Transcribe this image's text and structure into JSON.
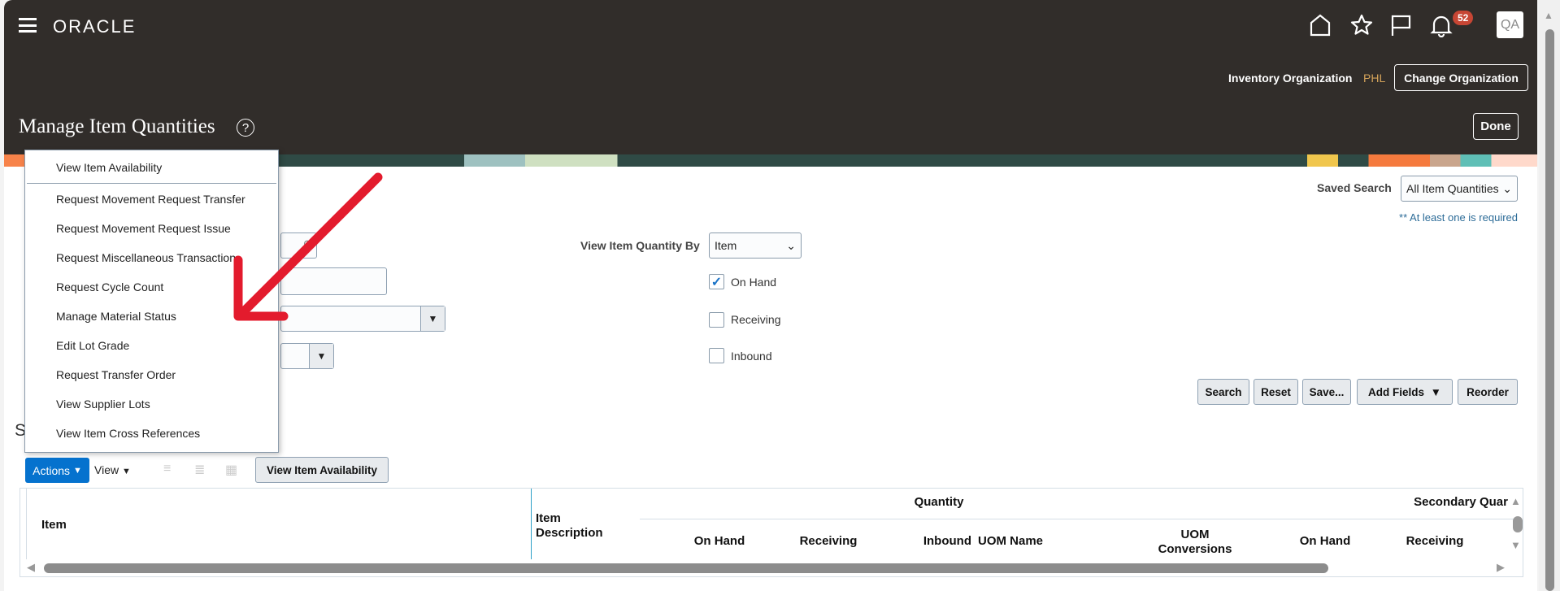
{
  "header": {
    "logo": "ORACLE",
    "notifications_count": "52",
    "avatar": "QA",
    "inventory_org_label": "Inventory Organization",
    "inventory_org_value": "PHL",
    "change_org_button": "Change Organization",
    "page_title": "Manage Item Quantities",
    "help": "?",
    "done_button": "Done"
  },
  "icons": [
    "menu-icon",
    "home-icon",
    "star-icon",
    "flag-icon",
    "bell-icon",
    "help-icon",
    "search-icon"
  ],
  "search": {
    "saved_search_label": "Saved Search",
    "saved_search_value": "All Item Quantities",
    "required_note": "** At least one is required",
    "view_by_label": "View Item Quantity By",
    "view_by_value": "Item",
    "checkboxes": [
      {
        "label": "On Hand",
        "checked": true
      },
      {
        "label": "Receiving",
        "checked": false
      },
      {
        "label": "Inbound",
        "checked": false
      }
    ],
    "buttons": {
      "search": "Search",
      "reset": "Reset",
      "save": "Save...",
      "add_fields": "Add Fields",
      "reorder": "Reorder"
    }
  },
  "results": {
    "heading_partial": "S",
    "actions": "Actions",
    "view": "View",
    "view_availability": "View Item Availability"
  },
  "actions_menu": [
    "View Item Availability",
    "Request Movement Request Transfer",
    "Request Movement Request Issue",
    "Request Miscellaneous Transaction",
    "Request Cycle Count",
    "Manage Material Status",
    "Edit Lot Grade",
    "Request Transfer Order",
    "View Supplier Lots",
    "View Item Cross References"
  ],
  "table": {
    "col_item": "Item",
    "col_desc": "Item Description",
    "group_quantity": "Quantity",
    "group_secondary": "Secondary Quar",
    "sub": [
      "On Hand",
      "Receiving",
      "Inbound",
      "UOM Name",
      "UOM Conversions",
      "On Hand",
      "Receiving"
    ]
  },
  "colors": {
    "header_bg": "#312d2a",
    "accent": "#0572ce",
    "annotation_arrow": "#e31b2d",
    "badge": "#c74634"
  }
}
